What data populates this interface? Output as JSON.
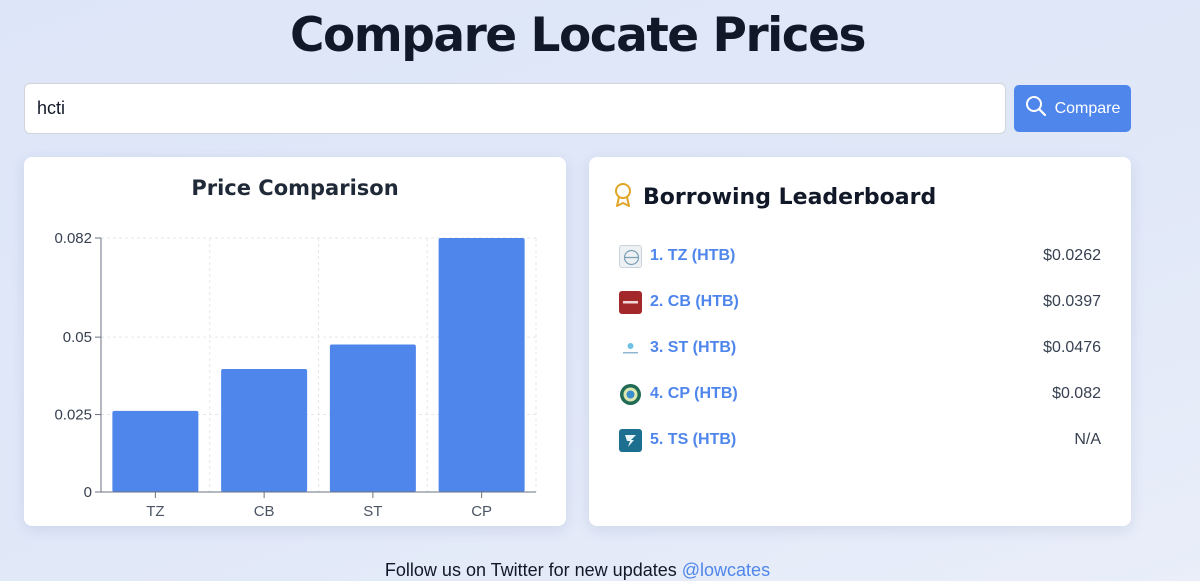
{
  "page": {
    "title": "Compare Locate Prices"
  },
  "search": {
    "value": "hcti",
    "button_label": "Compare"
  },
  "chart_card": {
    "title": "Price Comparison"
  },
  "chart_data": {
    "type": "bar",
    "categories": [
      "TZ",
      "CB",
      "ST",
      "CP"
    ],
    "values": [
      0.0262,
      0.0397,
      0.0476,
      0.082
    ],
    "title": "Price Comparison",
    "xlabel": "",
    "ylabel": "",
    "ylim": [
      0,
      0.082
    ],
    "yticks": [
      0,
      0.025,
      0.05,
      0.082
    ],
    "ytick_labels": [
      "0",
      "0.025",
      "0.05",
      "0.082"
    ],
    "grid": true,
    "bar_color": "#4f86ec"
  },
  "leaderboard": {
    "title": "Borrowing Leaderboard",
    "icon": "award-ribbon-icon",
    "items": [
      {
        "name": "1. TZ (HTB)",
        "price": "$0.0262",
        "logo": "tz-logo-icon"
      },
      {
        "name": "2. CB (HTB)",
        "price": "$0.0397",
        "logo": "cb-logo-icon"
      },
      {
        "name": "3. ST (HTB)",
        "price": "$0.0476",
        "logo": "st-logo-icon"
      },
      {
        "name": "4. CP (HTB)",
        "price": "$0.082",
        "logo": "cp-logo-icon"
      },
      {
        "name": "5. TS (HTB)",
        "price": "N/A",
        "logo": "ts-logo-icon"
      }
    ]
  },
  "footer": {
    "text": "Follow us on Twitter for new updates",
    "link_text": "@lowcates"
  },
  "colors": {
    "accent": "#4f86ec",
    "background": "#dde6f8"
  }
}
